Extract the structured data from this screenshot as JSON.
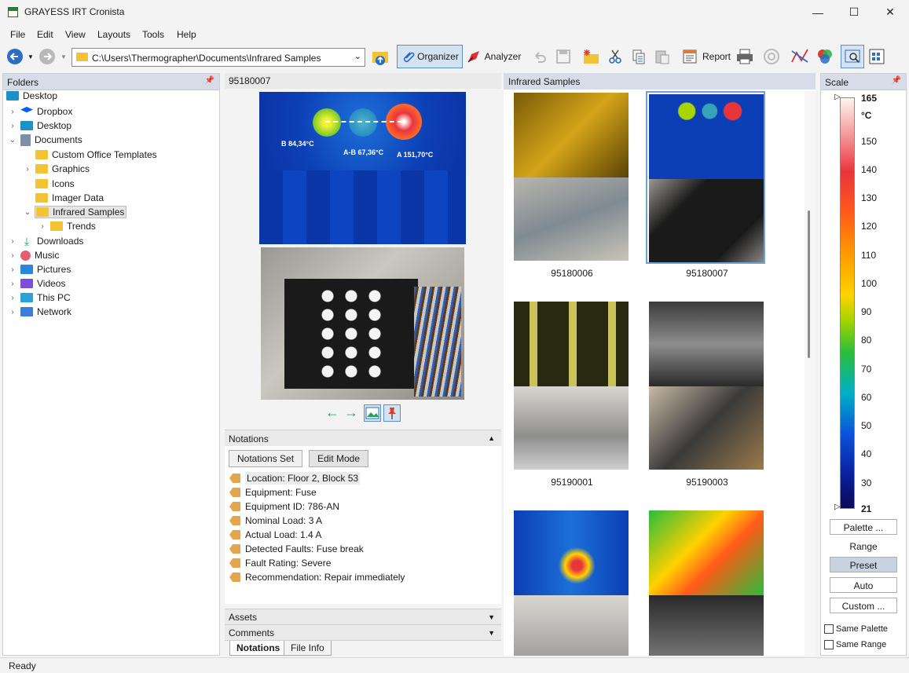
{
  "window": {
    "title": "GRAYESS IRT Cronista",
    "minimize": "—",
    "maximize": "☐",
    "close": "✕"
  },
  "menu": [
    "File",
    "Edit",
    "View",
    "Layouts",
    "Tools",
    "Help"
  ],
  "toolbar": {
    "address": "C:\\Users\\Thermographer\\Documents\\Infrared Samples",
    "organizer_label": "Organizer",
    "analyzer_label": "Analyzer",
    "report_label": "Report"
  },
  "folders": {
    "header": "Folders",
    "items": [
      {
        "label": "Desktop",
        "level": 0,
        "icon": "desktop-icon"
      },
      {
        "label": "Dropbox",
        "level": 1,
        "icon": "dropbox-icon"
      },
      {
        "label": "Desktop",
        "level": 1,
        "icon": "desktop-icon"
      },
      {
        "label": "Documents",
        "level": 1,
        "icon": "documents-icon"
      },
      {
        "label": "Custom Office Templates",
        "level": 2,
        "icon": "folder-icon"
      },
      {
        "label": "Graphics",
        "level": 2,
        "icon": "folder-icon"
      },
      {
        "label": "Icons",
        "level": 2,
        "icon": "folder-icon"
      },
      {
        "label": "Imager Data",
        "level": 2,
        "icon": "folder-icon"
      },
      {
        "label": "Infrared Samples",
        "level": 2,
        "icon": "folder-icon"
      },
      {
        "label": "Trends",
        "level": 3,
        "icon": "folder-icon"
      },
      {
        "label": "Downloads",
        "level": 1,
        "icon": "downloads-icon"
      },
      {
        "label": "Music",
        "level": 1,
        "icon": "music-icon"
      },
      {
        "label": "Pictures",
        "level": 1,
        "icon": "pictures-icon"
      },
      {
        "label": "Videos",
        "level": 1,
        "icon": "videos-icon"
      },
      {
        "label": "This PC",
        "level": 1,
        "icon": "pc-icon"
      },
      {
        "label": "Network",
        "level": 1,
        "icon": "network-icon"
      }
    ]
  },
  "image_viewer": {
    "title": "95180007",
    "labels": [
      "B 84,34°C",
      "A-B 67,36°C",
      "A 151,70°C"
    ]
  },
  "notations": {
    "header": "Notations",
    "set_button": "Notations Set",
    "edit_button": "Edit Mode",
    "items": [
      "Location: Floor 2, Block 53",
      "Equipment: Fuse",
      "Equipment ID: 786-AN",
      "Nominal Load: 3 A",
      "Actual Load: 1.4 A",
      "Detected Faults: Fuse break",
      "Fault Rating: Severe",
      "Recommendation: Repair immediately"
    ]
  },
  "assets_header": "Assets",
  "comments_header": "Comments",
  "tabs": [
    "Notations",
    "File Info"
  ],
  "thumbnails": {
    "header": "Infrared Samples",
    "items": [
      "95180006",
      "95180007",
      "95190001",
      "95190003",
      "",
      ""
    ]
  },
  "scale": {
    "header": "Scale",
    "max": "165",
    "unit": "°C",
    "ticks": [
      "150",
      "140",
      "130",
      "120",
      "110",
      "100",
      "90",
      "80",
      "70",
      "60",
      "50",
      "40",
      "30"
    ],
    "min": "21",
    "palette_button": "Palette ...",
    "range_label": "Range",
    "preset_button": "Preset",
    "auto_button": "Auto",
    "custom_button": "Custom ...",
    "same_palette": "Same Palette",
    "same_range": "Same Range"
  },
  "status": "Ready"
}
